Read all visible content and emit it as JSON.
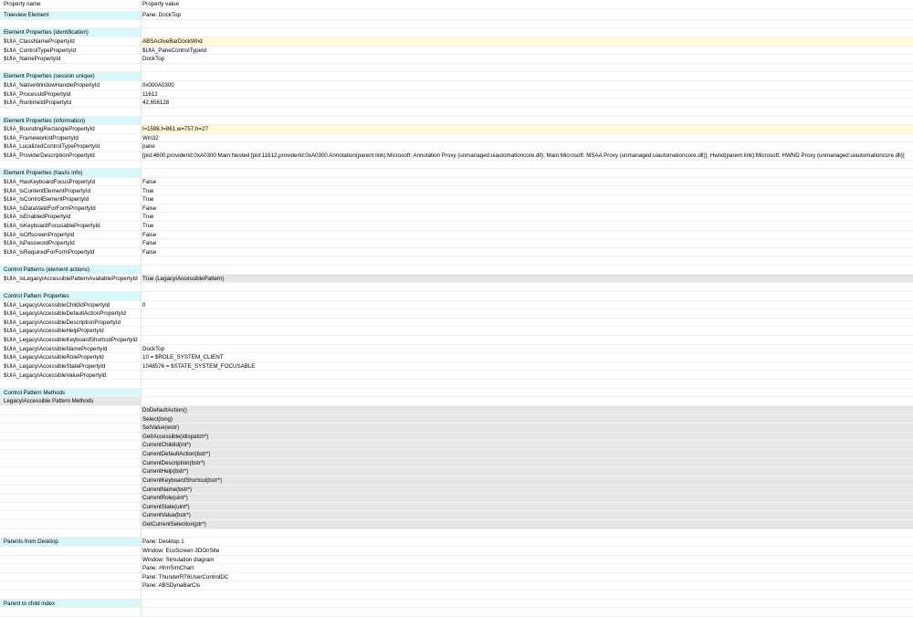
{
  "header": {
    "name": "Property name",
    "value": "Property value"
  },
  "rows": [
    {
      "name": "Treeview Element",
      "value": "Pane: DockTop",
      "kind": "section"
    },
    {
      "name": "",
      "value": "",
      "kind": "blank"
    },
    {
      "name": "Element Properties (identification)",
      "value": "",
      "kind": "section"
    },
    {
      "name": "$UIA_ClassNamePropertyId",
      "value": "ABSActiveBarDockWnd",
      "kind": "highlight"
    },
    {
      "name": "$UIA_ControlTypePropertyId",
      "value": "$UIA_PaneControlTypeId",
      "kind": "plain"
    },
    {
      "name": "$UIA_NamePropertyId",
      "value": "DockTop",
      "kind": "plain"
    },
    {
      "name": "",
      "value": "",
      "kind": "blank"
    },
    {
      "name": "Element Properties (session unique)",
      "value": "",
      "kind": "section"
    },
    {
      "name": "$UIA_NativeWindowHandlePropertyId",
      "value": "0x000A0300",
      "kind": "plain"
    },
    {
      "name": "$UIA_ProcessIdPropertyId",
      "value": "11612",
      "kind": "plain"
    },
    {
      "name": "$UIA_RuntimeIdPropertyId",
      "value": "42,656128",
      "kind": "plain"
    },
    {
      "name": "",
      "value": "",
      "kind": "blank"
    },
    {
      "name": "Element Properties (information)",
      "value": "",
      "kind": "section"
    },
    {
      "name": "$UIA_BoundingRectanglePropertyId",
      "value": "l=1598,t=861,w=757,h=27",
      "kind": "highlight"
    },
    {
      "name": "$UIA_FrameworkIdPropertyId",
      "value": "Win32",
      "kind": "plain"
    },
    {
      "name": "$UIA_LocalizedControlTypePropertyId",
      "value": "pane",
      "kind": "plain"
    },
    {
      "name": "$UIA_ProviderDescriptionPropertyId",
      "value": "[pid:4600,providerId:0xA0300 Main:Nested [pid:11612,providerId:0xA0300 Annotation(parent link):Microsoft: Annotation Proxy (unmanaged:uiautomationcore.dll); Main:Microsoft: MSAA Proxy (unmanaged:uiautomationcore.dll)]; Hwnd(parent link):Microsoft: HWND Proxy (unmanaged:uiautomationcore.dll)]",
      "kind": "plain"
    },
    {
      "name": "",
      "value": "",
      "kind": "blank"
    },
    {
      "name": "Element Properties (has/is info)",
      "value": "",
      "kind": "section"
    },
    {
      "name": "$UIA_HasKeyboardFocusPropertyId",
      "value": "False",
      "kind": "plain"
    },
    {
      "name": "$UIA_IsContentElementPropertyId",
      "value": "True",
      "kind": "plain"
    },
    {
      "name": "$UIA_IsControlElementPropertyId",
      "value": "True",
      "kind": "plain"
    },
    {
      "name": "$UIA_IsDataValidForFormPropertyId",
      "value": "False",
      "kind": "plain"
    },
    {
      "name": "$UIA_IsEnabledPropertyId",
      "value": "True",
      "kind": "plain"
    },
    {
      "name": "$UIA_IsKeyboardFocusablePropertyId",
      "value": "True",
      "kind": "plain"
    },
    {
      "name": "$UIA_IsOffscreenPropertyId",
      "value": "False",
      "kind": "plain"
    },
    {
      "name": "$UIA_IsPasswordPropertyId",
      "value": "False",
      "kind": "plain"
    },
    {
      "name": "$UIA_IsRequiredForFormPropertyId",
      "value": "False",
      "kind": "plain"
    },
    {
      "name": "",
      "value": "",
      "kind": "blank"
    },
    {
      "name": "Control Patterns (element actions)",
      "value": "",
      "kind": "section"
    },
    {
      "name": "$UIA_IsLegacyIAccessiblePatternAvailablePropertyId",
      "value": "True (LegacyIAccessiblePattern)",
      "kind": "gray"
    },
    {
      "name": "",
      "value": "",
      "kind": "blank"
    },
    {
      "name": "Control Pattern Properties",
      "value": "",
      "kind": "section"
    },
    {
      "name": "$UIA_LegacyIAccessibleChildIdPropertyId",
      "value": "0",
      "kind": "plain"
    },
    {
      "name": "$UIA_LegacyIAccessibleDefaultActionPropertyId",
      "value": "",
      "kind": "plain"
    },
    {
      "name": "$UIA_LegacyIAccessibleDescriptionPropertyId",
      "value": "",
      "kind": "plain"
    },
    {
      "name": "$UIA_LegacyIAccessibleHelpPropertyId",
      "value": "",
      "kind": "plain"
    },
    {
      "name": "$UIA_LegacyIAccessibleKeyboardShortcutPropertyId",
      "value": "",
      "kind": "plain"
    },
    {
      "name": "$UIA_LegacyIAccessibleNamePropertyId",
      "value": "DockTop",
      "kind": "plain"
    },
    {
      "name": "$UIA_LegacyIAccessibleRolePropertyId",
      "value": "10 = $ROLE_SYSTEM_CLIENT",
      "kind": "plain"
    },
    {
      "name": "$UIA_LegacyIAccessibleStatePropertyId",
      "value": "1048576 = $STATE_SYSTEM_FOCUSABLE",
      "kind": "plain"
    },
    {
      "name": "$UIA_LegacyIAccessibleValuePropertyId",
      "value": "",
      "kind": "plain"
    },
    {
      "name": "",
      "value": "",
      "kind": "blank"
    },
    {
      "name": "Control Pattern Methods",
      "value": "",
      "kind": "section"
    },
    {
      "name": "LegacyIAccessible Pattern Methods",
      "value": "",
      "kind": "graylabel"
    },
    {
      "name": "",
      "value": "DoDefaultAction()",
      "kind": "gray"
    },
    {
      "name": "",
      "value": "Select(long)",
      "kind": "gray"
    },
    {
      "name": "",
      "value": "SetValue(wstr)",
      "kind": "gray"
    },
    {
      "name": "",
      "value": "GetIAccessible(idispatch*)",
      "kind": "gray"
    },
    {
      "name": "",
      "value": "CurrentChildId(int*)",
      "kind": "gray"
    },
    {
      "name": "",
      "value": "CurrentDefaultAction(bstr*)",
      "kind": "gray"
    },
    {
      "name": "",
      "value": "CurrentDescription(bstr*)",
      "kind": "gray"
    },
    {
      "name": "",
      "value": "CurrentHelp(bstr*)",
      "kind": "gray"
    },
    {
      "name": "",
      "value": "CurrentKeyboardShortcut(bstr*)",
      "kind": "gray"
    },
    {
      "name": "",
      "value": "CurrentName(bstr*)",
      "kind": "gray"
    },
    {
      "name": "",
      "value": "CurrentRole(uint*)",
      "kind": "gray"
    },
    {
      "name": "",
      "value": "CurrentState(uint*)",
      "kind": "gray"
    },
    {
      "name": "",
      "value": "CurrentValue(bstr*)",
      "kind": "gray"
    },
    {
      "name": "",
      "value": "GetCurrentSelection(ptr*)",
      "kind": "gray"
    },
    {
      "name": "",
      "value": "",
      "kind": "blank"
    },
    {
      "name": "Parents from Desktop",
      "value": "Pane: Desktop 1",
      "kind": "section"
    },
    {
      "name": "",
      "value": "Window: EcoScreen 3DOnSite",
      "kind": "plain"
    },
    {
      "name": "",
      "value": "Window: Simulation diagram",
      "kind": "plain"
    },
    {
      "name": "",
      "value": "Pane: #frmSimChart",
      "kind": "plain"
    },
    {
      "name": "",
      "value": "Pane: ThunderRT6UserControlDC",
      "kind": "plain"
    },
    {
      "name": "",
      "value": "Pane: ABSDynaBarCls",
      "kind": "plain"
    },
    {
      "name": "",
      "value": "",
      "kind": "blank"
    },
    {
      "name": "Parent to child index",
      "value": "",
      "kind": "section"
    },
    {
      "name": "",
      "value": "",
      "kind": "blank"
    }
  ]
}
